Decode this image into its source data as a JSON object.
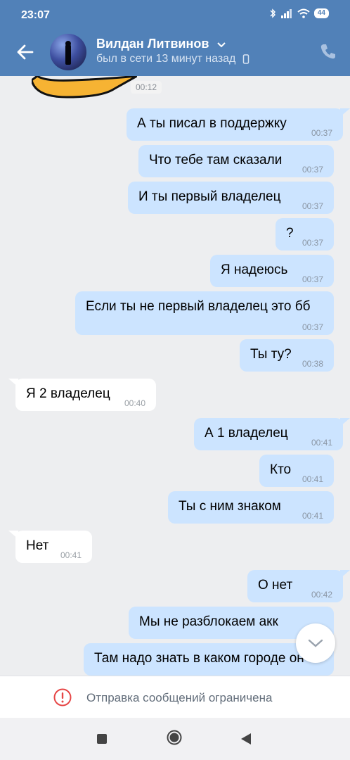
{
  "status_bar": {
    "time": "23:07",
    "battery": "44"
  },
  "header": {
    "name": "Вилдан Литвинов",
    "status": "был в сети 13 минут назад"
  },
  "chat": {
    "sticker_time": "00:12",
    "messages": [
      {
        "dir": "out",
        "text": "А ты писал в поддержку",
        "time": "00:37"
      },
      {
        "dir": "out",
        "text": "Что тебе там сказали",
        "time": "00:37"
      },
      {
        "dir": "out",
        "text": "И ты первый владелец",
        "time": "00:37"
      },
      {
        "dir": "out",
        "text": "?",
        "time": "00:37"
      },
      {
        "dir": "out",
        "text": "Я надеюсь",
        "time": "00:37"
      },
      {
        "dir": "out",
        "text": "Если ты не первый владелец это бб",
        "time": "00:37"
      },
      {
        "dir": "out",
        "text": "Ты ту?",
        "time": "00:38"
      },
      {
        "dir": "in",
        "text": "Я 2 владелец",
        "time": "00:40"
      },
      {
        "dir": "out",
        "text": "А 1 владелец",
        "time": "00:41"
      },
      {
        "dir": "out",
        "text": "Кто",
        "time": "00:41"
      },
      {
        "dir": "out",
        "text": "Ты с ним знаком",
        "time": "00:41"
      },
      {
        "dir": "in",
        "text": "Нет",
        "time": "00:41"
      },
      {
        "dir": "out",
        "text": "О нет",
        "time": "00:42"
      },
      {
        "dir": "out",
        "text": "Мы не разблокаем акк",
        "time": ""
      },
      {
        "dir": "out",
        "text": "Там надо знать в каком городе он",
        "time": ""
      }
    ]
  },
  "restriction": {
    "text": "Отправка сообщений ограничена"
  },
  "colors": {
    "header": "#5181b8",
    "outgoing": "#cce4ff",
    "incoming": "#ffffff",
    "background": "#edeef0",
    "warning": "#e64646"
  },
  "icons": [
    "back-arrow-icon",
    "chevron-down-icon",
    "phone-icon",
    "mobile-icon",
    "chevron-down-scroll-icon",
    "warning-icon",
    "nav-recents-icon",
    "nav-home-icon",
    "nav-back-icon"
  ]
}
